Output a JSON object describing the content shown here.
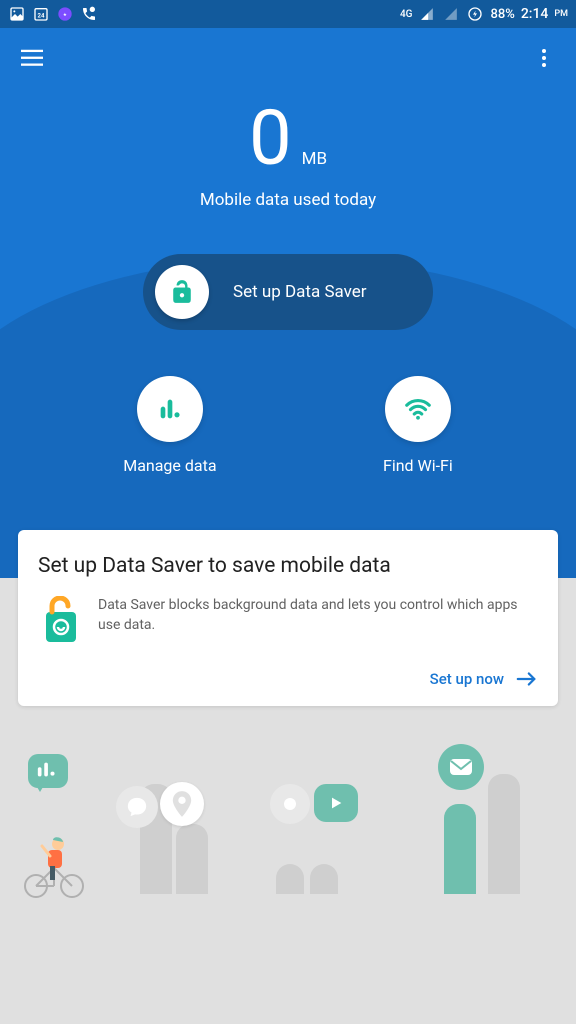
{
  "status": {
    "network": "4G",
    "battery": "88%",
    "time": "2:14",
    "ampm": "PM"
  },
  "hero": {
    "value": "0",
    "unit": "MB",
    "subtitle": "Mobile data used today"
  },
  "pill": {
    "label": "Set up Data Saver"
  },
  "actions": {
    "manage": "Manage data",
    "wifi": "Find Wi-Fi"
  },
  "card": {
    "title": "Set up Data Saver to save mobile data",
    "body": "Data Saver blocks background data and lets you control which apps use data.",
    "cta": "Set up now"
  }
}
